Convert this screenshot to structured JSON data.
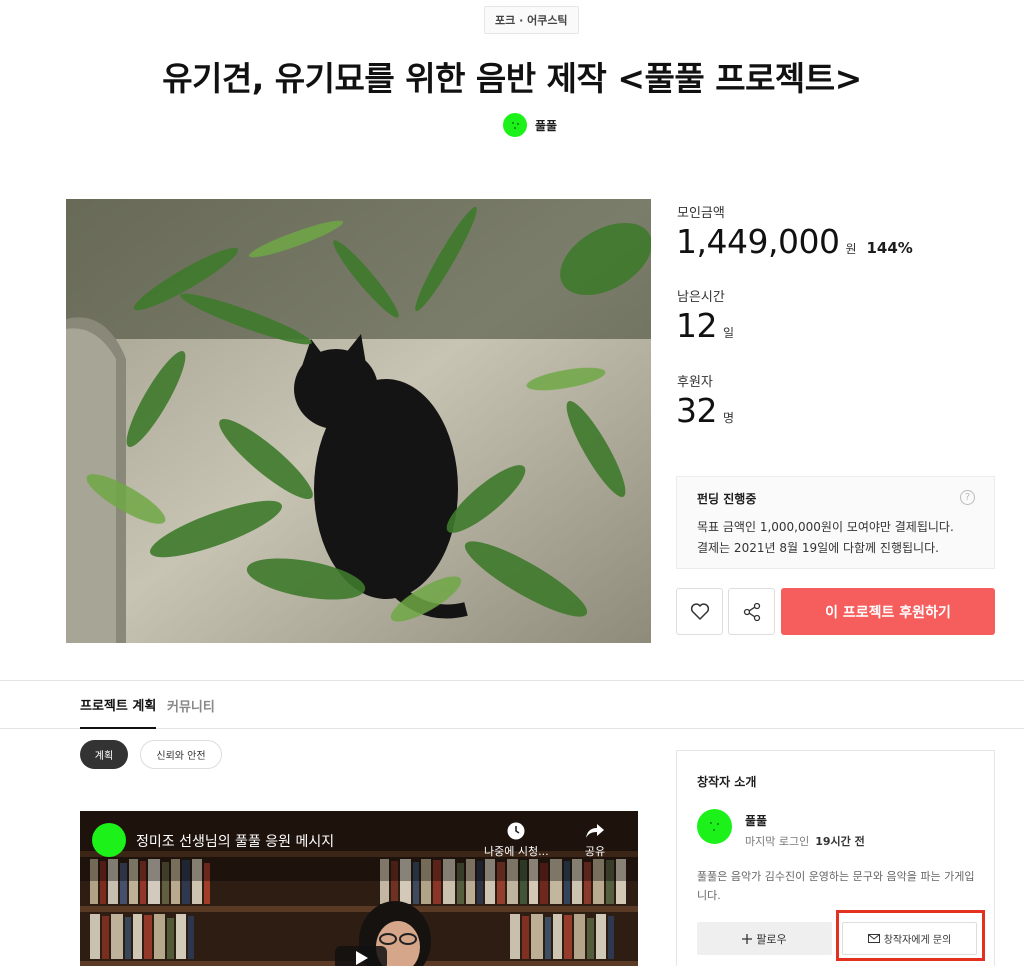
{
  "header": {
    "category": "포크 · 어쿠스틱",
    "title": "유기견, 유기묘를 위한 음반 제작 <풀풀 프로젝트>",
    "creator_name": "풀풀"
  },
  "stats": {
    "raised_label": "모인금액",
    "raised_value": "1,449,000",
    "raised_unit": "원",
    "raised_percent": "144%",
    "time_label": "남은시간",
    "time_value": "12",
    "time_unit": "일",
    "backers_label": "후원자",
    "backers_value": "32",
    "backers_unit": "명"
  },
  "funding_box": {
    "heading": "펀딩 진행중",
    "line1": "목표 금액인 1,000,000원이 모여야만 결제됩니다.",
    "line2": "결제는 2021년 8월 19일에 다함께 진행됩니다.",
    "help": "?"
  },
  "actions": {
    "back_label": "이 프로젝트 후원하기",
    "like_icon": "heart-icon",
    "share_icon": "share-icon"
  },
  "tabs": [
    {
      "label": "프로젝트 계획",
      "active": true
    },
    {
      "label": "커뮤니티",
      "active": false
    }
  ],
  "subtabs": [
    {
      "label": "계획",
      "active": true
    },
    {
      "label": "신뢰와 안전",
      "active": false
    }
  ],
  "video": {
    "title": "정미조 선생님의 풀풀 응원 메시지",
    "watch_later": "나중에 시청...",
    "share": "공유"
  },
  "creator_card": {
    "heading": "창작자 소개",
    "name": "풀풀",
    "last_login_label": "마지막 로그인",
    "last_login_value": "19시간 전",
    "description": "풀풀은 음악가 김수진이 운영하는 문구와 음악을 파는 가게입니다.",
    "follow_label": "팔로우",
    "contact_label": "창작자에게 문의"
  },
  "colors": {
    "accent": "#f65d5d",
    "avatar": "#1cf21a",
    "highlight": "#e3301f"
  }
}
